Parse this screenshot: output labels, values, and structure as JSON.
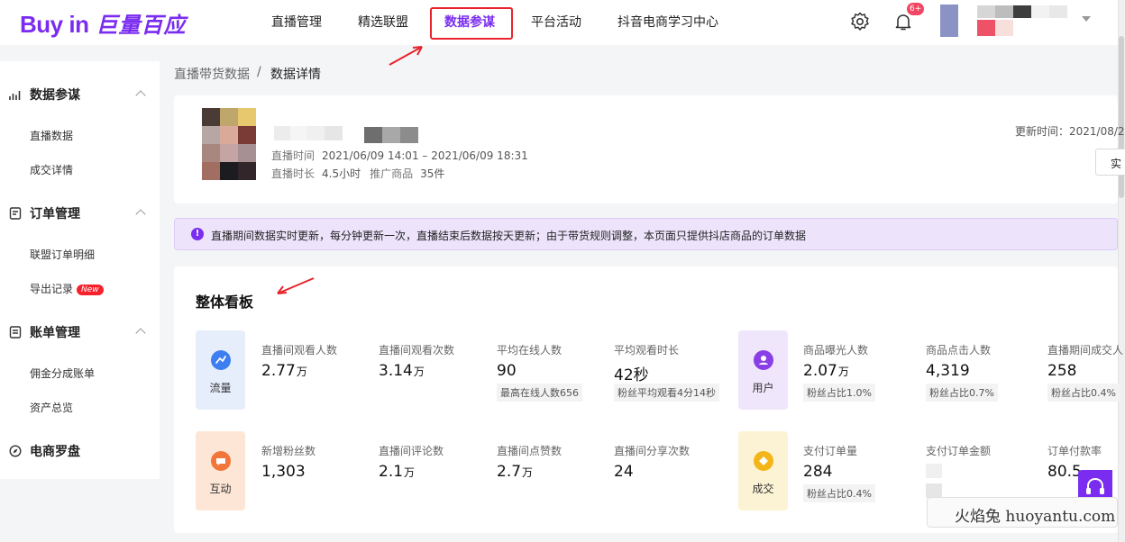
{
  "header": {
    "logo_left": "Buy in",
    "logo_right": "巨量百应",
    "nav": [
      {
        "label": "直播管理"
      },
      {
        "label": "精选联盟"
      },
      {
        "label": "数据参谋",
        "active": true
      },
      {
        "label": "平台活动"
      },
      {
        "label": "抖音电商学习中心"
      }
    ],
    "notification_count": "6+",
    "icons": [
      "gear-icon",
      "bell-icon",
      "chevron-down-icon"
    ]
  },
  "sidebar": {
    "groups": [
      {
        "label": "数据参谋",
        "icon": "chart-icon",
        "items": [
          {
            "label": "直播数据"
          },
          {
            "label": "成交详情"
          }
        ]
      },
      {
        "label": "订单管理",
        "icon": "list-icon",
        "items": [
          {
            "label": "联盟订单明细"
          },
          {
            "label": "导出记录",
            "badge": "New"
          }
        ]
      },
      {
        "label": "账单管理",
        "icon": "bill-icon",
        "items": [
          {
            "label": "佣金分成账单"
          },
          {
            "label": "资产总览"
          }
        ]
      },
      {
        "label": "电商罗盘",
        "icon": "compass-icon",
        "items": []
      }
    ]
  },
  "breadcrumb": {
    "parent": "直播带货数据",
    "separator": "/",
    "current": "数据详情"
  },
  "live": {
    "time_label": "直播时间",
    "time_value": "2021/06/09 14:01 – 2021/06/09 18:31",
    "duration_label": "直播时长",
    "duration_value": "4.5小时",
    "products_label": "推广商品",
    "products_value": "35件",
    "update_time": "更新时间：2021/08/2",
    "side_button": "实"
  },
  "notice": {
    "icon": "!",
    "text": "直播期间数据实时更新，每分钟更新一次，直播结束后数据按天更新；由于带货规则调整，本页面只提供抖店商品的订单数据"
  },
  "dashboard": {
    "title": "整体看板",
    "categories": {
      "traffic": {
        "label": "流量",
        "color": "#e6eefc",
        "icon_color": "#3d7ef0",
        "icon": "trend-icon"
      },
      "user": {
        "label": "用户",
        "color": "#f0e6fb",
        "icon_color": "#8a3fe6",
        "icon": "user-icon"
      },
      "interact": {
        "label": "互动",
        "color": "#fde6d6",
        "icon_color": "#f2763a",
        "icon": "chat-icon"
      },
      "deal": {
        "label": "成交",
        "color": "#fcf3d4",
        "icon_color": "#f4b518",
        "icon": "diamond-icon"
      }
    },
    "metrics": {
      "viewers": {
        "label": "直播间观看人数",
        "value": "2.77",
        "unit": "万"
      },
      "views": {
        "label": "直播间观看次数",
        "value": "3.14",
        "unit": "万"
      },
      "avg_online": {
        "label": "平均在线人数",
        "value": "90",
        "sub": "最高在线人数656"
      },
      "avg_watch": {
        "label": "平均观看时长",
        "value": "42秒",
        "sub": "粉丝平均观看4分14秒"
      },
      "exposure": {
        "label": "商品曝光人数",
        "value": "2.07",
        "unit": "万",
        "sub": "粉丝占比1.0%"
      },
      "clicks": {
        "label": "商品点击人数",
        "value": "4,319",
        "sub": "粉丝占比0.7%"
      },
      "buyers": {
        "label": "直播期间成交人",
        "value": "258",
        "sub": "粉丝占比0.4%"
      },
      "new_fans": {
        "label": "新增粉丝数",
        "value": "1,303"
      },
      "comments": {
        "label": "直播间评论数",
        "value": "2.1",
        "unit": "万"
      },
      "likes": {
        "label": "直播间点赞数",
        "value": "2.7",
        "unit": "万"
      },
      "shares": {
        "label": "直播间分享次数",
        "value": "24"
      },
      "orders": {
        "label": "支付订单量",
        "value": "284",
        "sub": "粉丝占比0.4%"
      },
      "amount": {
        "label": "支付订单金额",
        "value": ""
      },
      "pay_rate": {
        "label": "订单付款率",
        "value": "80.5"
      }
    }
  },
  "watermark": "火焰兔 huoyantu.com"
}
